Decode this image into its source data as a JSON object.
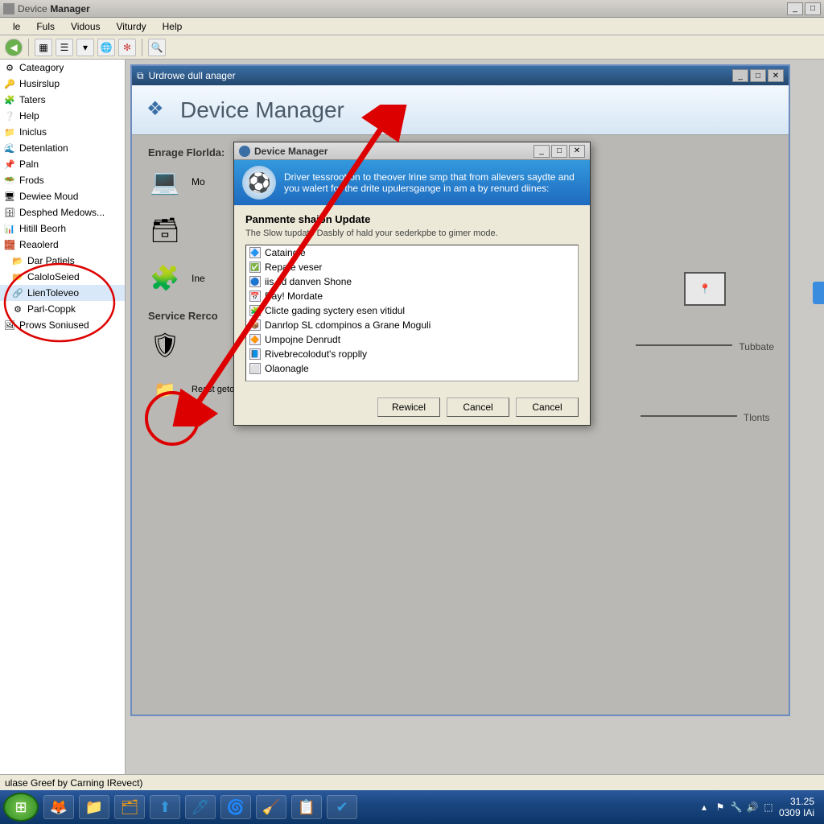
{
  "main_window": {
    "title_prefix": "Device",
    "title_bold": "Manager"
  },
  "menubar": [
    "le",
    "Fuls",
    "Vidous",
    "Viturdy",
    "Help"
  ],
  "sidebar": {
    "items": [
      {
        "icon": "⚙",
        "label": "Cateagory"
      },
      {
        "icon": "🔑",
        "label": "Husirslup"
      },
      {
        "icon": "🧩",
        "label": "Taters"
      },
      {
        "icon": "❔",
        "label": "Help"
      },
      {
        "icon": "📁",
        "label": "Iniclus"
      },
      {
        "icon": "🌊",
        "label": "Detenlation"
      },
      {
        "icon": "📌",
        "label": "Paln"
      },
      {
        "icon": "🥗",
        "label": "Frods"
      },
      {
        "icon": "🖥",
        "label": "Dewiee Moud"
      },
      {
        "icon": "🗄",
        "label": "Desphed Medows..."
      },
      {
        "icon": "📊",
        "label": "Hitill Beorh"
      },
      {
        "icon": "🧱",
        "label": "Reaolerd"
      },
      {
        "icon": "📂",
        "label": "Dar Patiels",
        "indent": true
      },
      {
        "icon": "📂",
        "label": "CaloloSeied",
        "indent": true
      },
      {
        "icon": "🔗",
        "label": "LienToleveo",
        "indent": true,
        "selected": true
      },
      {
        "icon": "⚙",
        "label": "Parl-Coppk",
        "indent": true
      },
      {
        "icon": "🖼",
        "label": "Prows Soniused"
      }
    ]
  },
  "inner_window": {
    "titlebar": "Urdrowe dull anager",
    "header": "Device Manager",
    "section1_label": "Enrage Florlda:",
    "section1_items": [
      "Mo",
      "Ine"
    ],
    "section2_label": "Service Rerco",
    "bottom_item": "Reast getonniso",
    "widget1_label": "Tubbate",
    "widget2_label": "Tlonts"
  },
  "modal": {
    "title": "Device Manager",
    "banner_text": "Driver tessroot on to theover lrine smp that from allevers saydte and you walert for the drite upulersgange in am a by renurd diines:",
    "heading": "Panmente shaion Update",
    "description": "The Slow tupdate Dasbly of hald your sederkpbe to gimer mode.",
    "list": [
      "Cataingle",
      "Repate veser",
      "iis Ild danven Shone",
      "Day! Mordate",
      "Clicte gading syctery esen vitidul",
      "Danrlop SL cdompinos a Grane Moguli",
      "Umpojne Denrudt",
      "Rivebrecolodut's ropplly",
      "Olaonagle"
    ],
    "buttons": [
      "Rewicel",
      "Cancel",
      "Cancel"
    ]
  },
  "statusbar": "ulase Greef by Carning IRevect)",
  "systray": {
    "time": "31.25",
    "date": "0309 IAi"
  }
}
